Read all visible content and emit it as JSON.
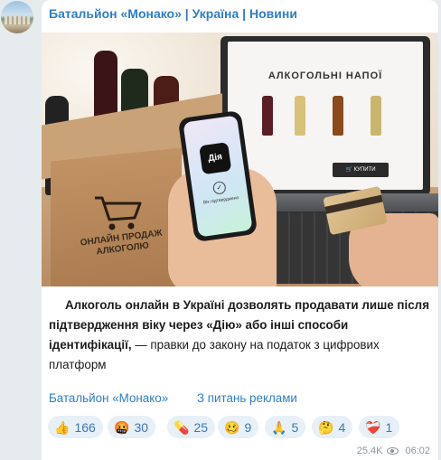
{
  "channel": {
    "title": "Батальйон «Монако» | Україна | Новини"
  },
  "photo": {
    "store_heading": "АЛКОГОЛЬНІ НАПОЇ",
    "buy_label": "КУПИТИ",
    "box_text": "ОНЛАЙН ПРОДАЖ АЛКОГОЛЮ",
    "phone_app": "Дія",
    "phone_status": "Вік підтверджено"
  },
  "message": {
    "lead": "Алкоголь онлайн в Україні дозволять продавати лише після підтвердження віку через «Дію» або інші способи ідентифікації,",
    "rest": " — правки до закону на податок з цифрових платформ"
  },
  "footer": {
    "link_channel": "Батальйон «Монако»",
    "link_ads": "З питань реклами"
  },
  "reactions": [
    {
      "emoji": "👍",
      "count": "166"
    },
    {
      "emoji": "🤬",
      "count": "30"
    },
    {
      "emoji": "💊",
      "count": "25"
    },
    {
      "emoji": "🥴",
      "count": "9"
    },
    {
      "emoji": "🙏",
      "count": "5"
    },
    {
      "emoji": "🤔",
      "count": "4"
    },
    {
      "emoji": "❤️‍🩹",
      "count": "1"
    }
  ],
  "meta": {
    "views": "25.4K",
    "time": "06:02"
  },
  "colors": {
    "accent": "#2f7ec4",
    "reaction_bg": "#e7eff7",
    "chat_bg": "#e6ebee"
  }
}
